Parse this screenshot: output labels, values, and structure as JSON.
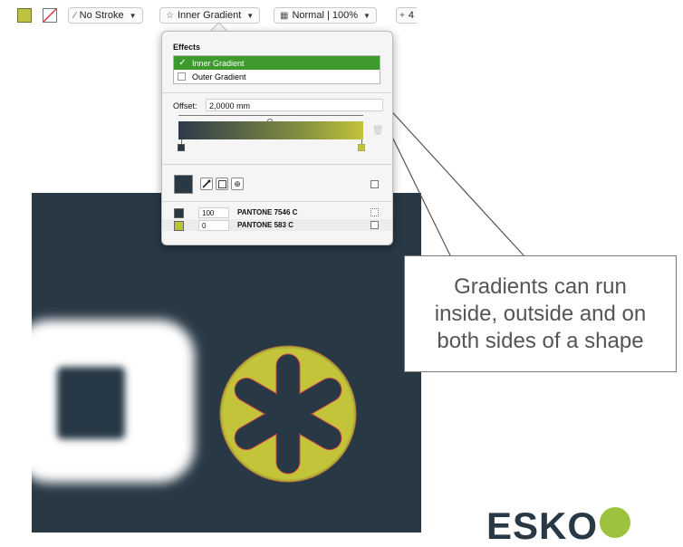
{
  "toolbar": {
    "fill_color": "#bcc33c",
    "stroke_label": "No Stroke",
    "stroke_icon": "pen-icon",
    "effect_label": "Inner Gradient",
    "effect_icon": "star-icon",
    "blend_label": "Normal | 100%",
    "blend_icon": "blend-icon",
    "extra_label": "4"
  },
  "effects_panel": {
    "title": "Effects",
    "items": [
      {
        "label": "Inner Gradient",
        "checked": true
      },
      {
        "label": "Outer Gradient",
        "checked": false
      }
    ],
    "offset_label": "Offset:",
    "offset_value": "2,0000 mm",
    "gradient_start_color": "#2c3a4a",
    "gradient_end_color": "#c3c43a",
    "inks": [
      {
        "value": "100",
        "name": "PANTONE 7546 C",
        "color": "#283845"
      },
      {
        "value": "0",
        "name": "PANTONE 583 C",
        "color": "#b8c23a"
      }
    ]
  },
  "callout": {
    "text_line1": "Gradients can run",
    "text_line2": "inside, outside and on",
    "text_line3": "both sides of a shape"
  },
  "artwork": {
    "background_color": "#283845",
    "accent_color": "#c3c43a"
  },
  "brand": {
    "logo_text": "ESKO"
  }
}
